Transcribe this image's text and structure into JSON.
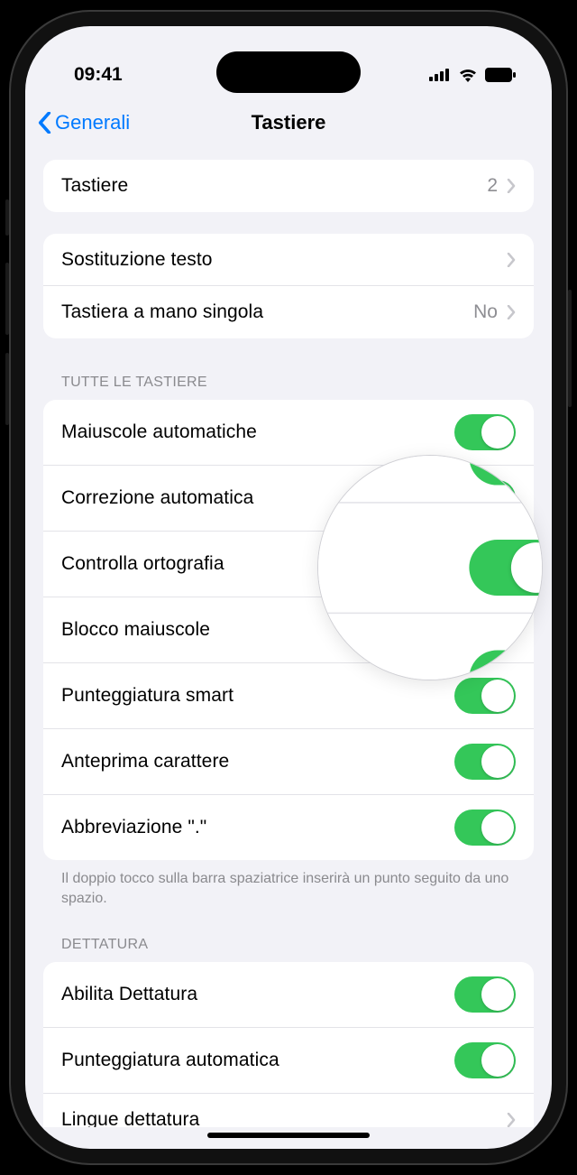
{
  "status": {
    "time": "09:41"
  },
  "nav": {
    "back_label": "Generali",
    "title": "Tastiere"
  },
  "keyboards_row": {
    "label": "Tastiere",
    "value": "2"
  },
  "group2": {
    "text_replacement": "Sostituzione testo",
    "one_handed": {
      "label": "Tastiera a mano singola",
      "value": "No"
    }
  },
  "all_keyboards": {
    "header": "TUTTE LE TASTIERE",
    "auto_caps": "Maiuscole automatiche",
    "auto_correct": "Correzione automatica",
    "spell_check": "Controlla ortografia",
    "caps_lock": "Blocco maiuscole",
    "smart_punct": "Punteggiatura smart",
    "char_preview": "Anteprima carattere",
    "period_shortcut": "Abbreviazione \".\"",
    "footer": "Il doppio tocco sulla barra spaziatrice inserirà un punto seguito da uno spazio."
  },
  "dictation": {
    "header": "DETTATURA",
    "enable": "Abilita Dettatura",
    "auto_punct": "Punteggiatura automatica",
    "languages": "Lingue dettatura"
  },
  "colors": {
    "accent": "#007aff",
    "toggle_on": "#34c759",
    "bg": "#f2f2f7"
  }
}
